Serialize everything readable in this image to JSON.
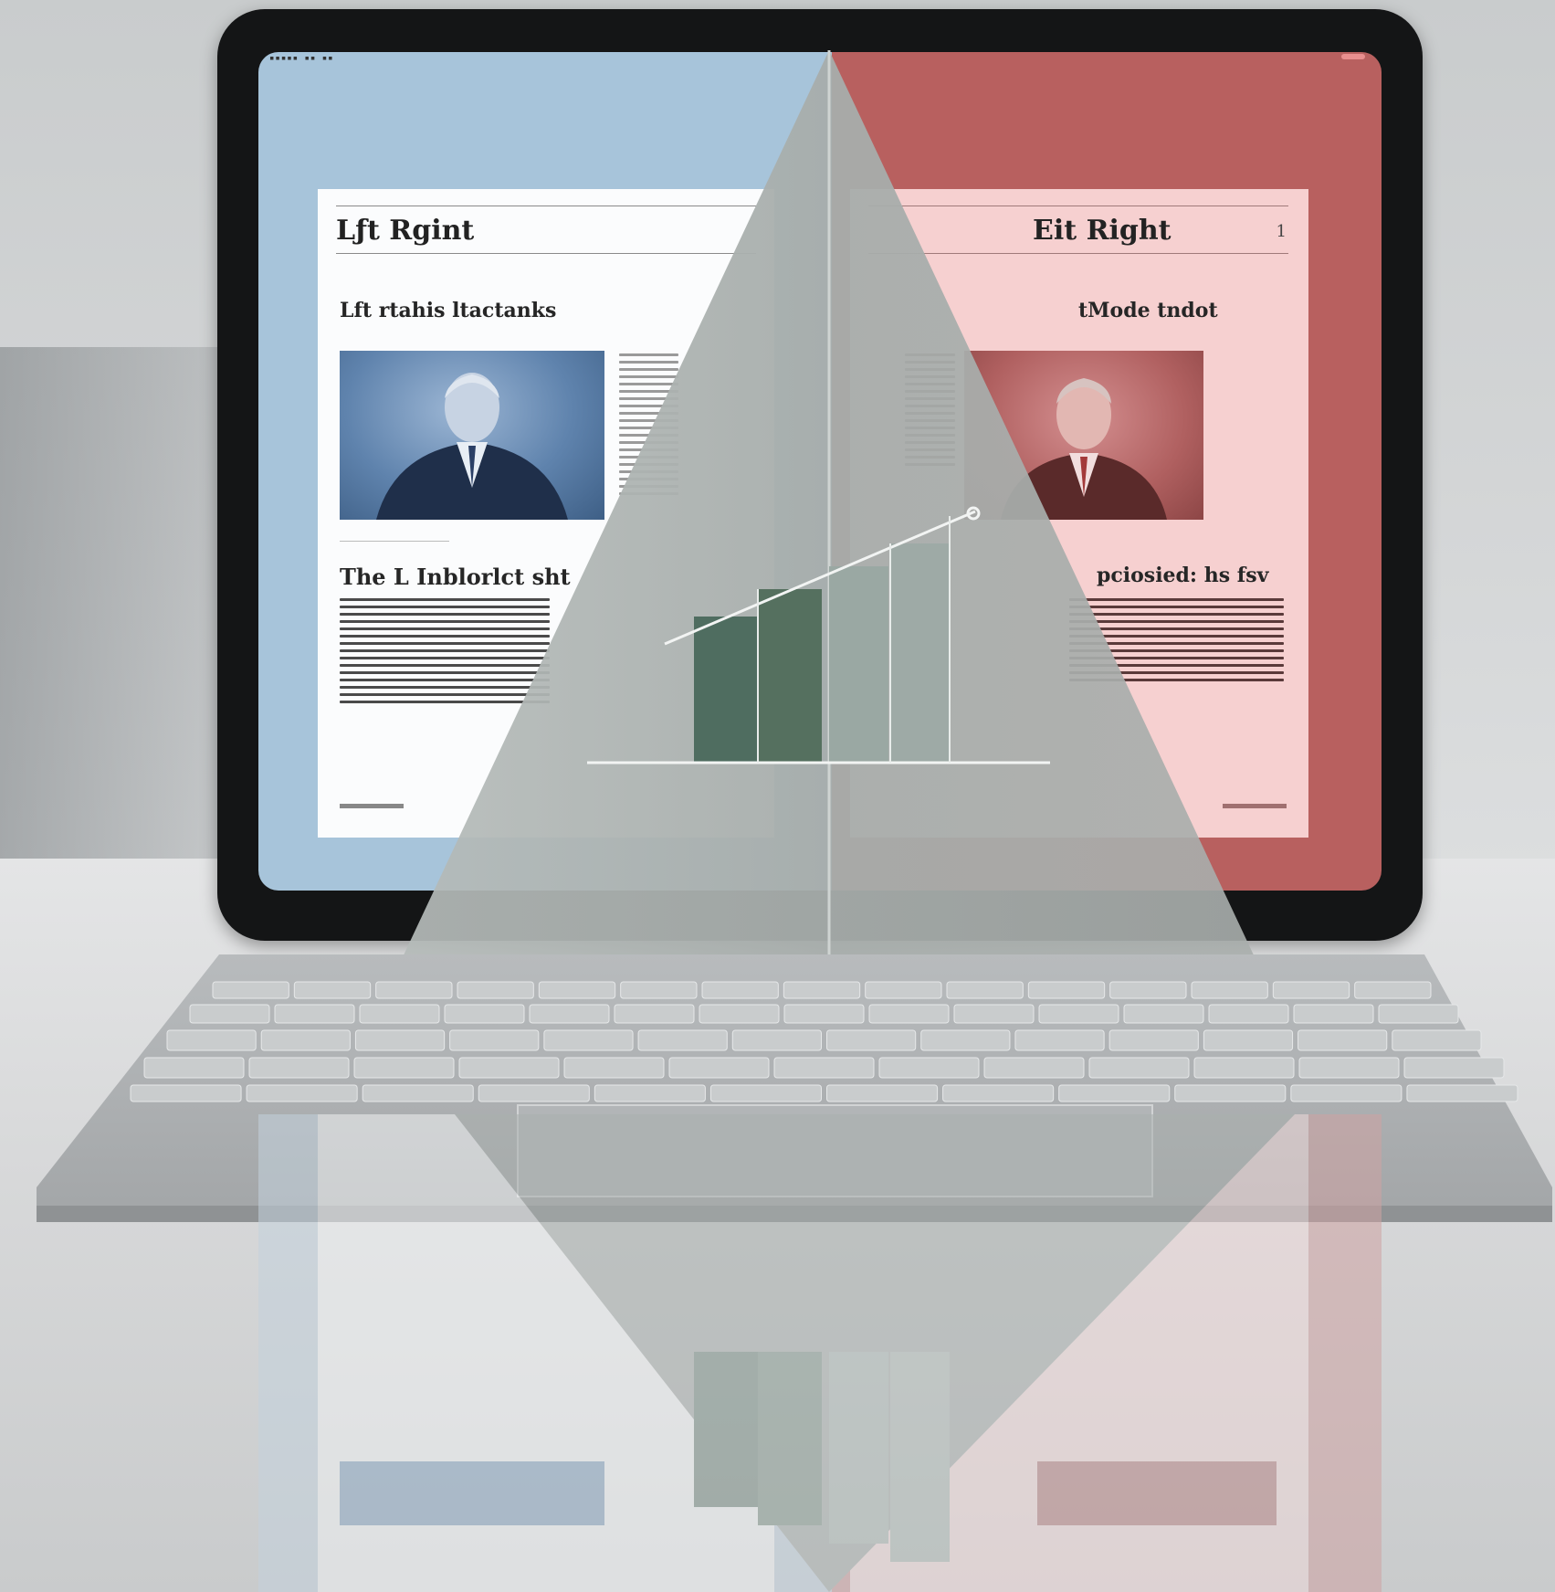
{
  "left_page": {
    "masthead": "Lƒt Rgint",
    "headline_1": "Lft rtahis ltactanks",
    "headline_2": "The L Inblorlct sht"
  },
  "right_page": {
    "masthead": "Eit Right",
    "page_number": "1",
    "headline_1": "tMode tndot",
    "headline_2": "pciosied: hs fsv"
  },
  "colors": {
    "left_panel": "#a7c4da",
    "right_panel": "#b8605f",
    "left_page_bg": "#fbfcfd",
    "right_page_bg": "#f6d0d0",
    "prism": "#a9b0ae",
    "bar_dark": "#4f6d60",
    "bar_light": "#9aa8a3"
  }
}
